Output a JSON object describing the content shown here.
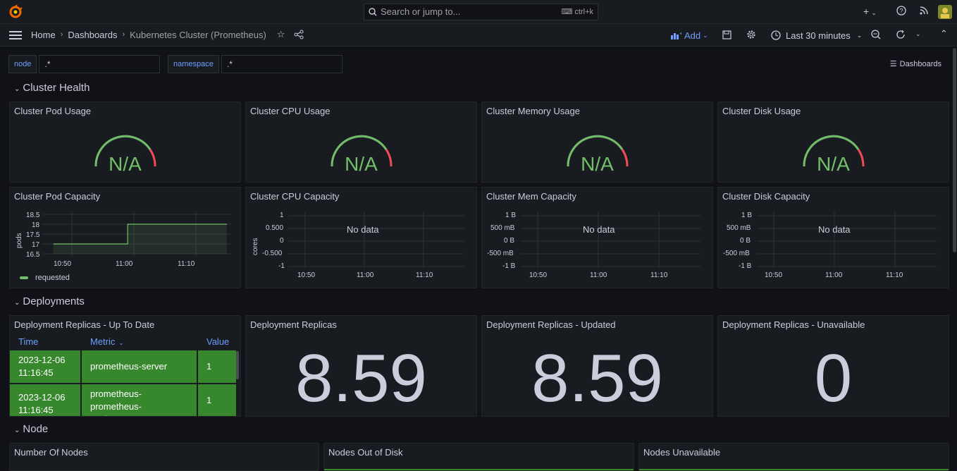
{
  "topbar": {
    "search_placeholder": "Search or jump to...",
    "search_shortcut": "ctrl+k",
    "plus_label": "+"
  },
  "nav": {
    "breadcrumbs": [
      "Home",
      "Dashboards",
      "Kubernetes Cluster (Prometheus)"
    ],
    "add_label": "Add",
    "time_range": "Last 30 minutes"
  },
  "variables": [
    {
      "label": "node",
      "value": ".*"
    },
    {
      "label": "namespace",
      "value": ".*"
    }
  ],
  "dashboards_link": "Dashboards",
  "rows": {
    "cluster_health": "Cluster Health",
    "deployments": "Deployments",
    "node": "Node"
  },
  "gauges": [
    {
      "title": "Cluster Pod Usage",
      "value": "N/A"
    },
    {
      "title": "Cluster CPU Usage",
      "value": "N/A"
    },
    {
      "title": "Cluster Memory Usage",
      "value": "N/A"
    },
    {
      "title": "Cluster Disk Usage",
      "value": "N/A"
    }
  ],
  "capacity": {
    "pod": {
      "title": "Cluster Pod Capacity",
      "ylabel": "pods",
      "yticks": [
        "18.5",
        "18",
        "17.5",
        "17",
        "16.5"
      ],
      "xticks": [
        "10:50",
        "11:00",
        "11:10"
      ],
      "legend": "requested"
    },
    "cpu": {
      "title": "Cluster CPU Capacity",
      "ylabel": "cores",
      "yticks": [
        "1",
        "0.500",
        "0",
        "-0.500",
        "-1"
      ],
      "xticks": [
        "10:50",
        "11:00",
        "11:10"
      ],
      "no_data": "No data"
    },
    "mem": {
      "title": "Cluster Mem Capacity",
      "yticks": [
        "1 B",
        "500 mB",
        "0 B",
        "-500 mB",
        "-1 B"
      ],
      "xticks": [
        "10:50",
        "11:00",
        "11:10"
      ],
      "no_data": "No data"
    },
    "disk": {
      "title": "Cluster Disk Capacity",
      "yticks": [
        "1 B",
        "500 mB",
        "0 B",
        "-500 mB",
        "-1 B"
      ],
      "xticks": [
        "10:50",
        "11:00",
        "11:10"
      ],
      "no_data": "No data"
    }
  },
  "chart_data": {
    "type": "line",
    "title": "Cluster Pod Capacity",
    "ylabel": "pods",
    "ylim": [
      16.5,
      18.5
    ],
    "xticks": [
      "10:50",
      "11:00",
      "11:10"
    ],
    "series": [
      {
        "name": "requested",
        "x": [
          "10:47",
          "10:51",
          "10:55",
          "10:59",
          "10:59",
          "11:03",
          "11:07",
          "11:11",
          "11:15"
        ],
        "values": [
          17,
          17,
          17,
          17,
          18,
          18,
          18,
          18,
          18
        ]
      }
    ]
  },
  "deployments": {
    "table": {
      "title": "Deployment Replicas - Up To Date",
      "headers": [
        "Time",
        "Metric",
        "Value"
      ],
      "rows": [
        {
          "time": "2023-12-06 11:16:45",
          "metric": "prometheus-server",
          "value": "1"
        },
        {
          "time": "2023-12-06 11:16:45",
          "metric": "prometheus-prometheus-pushgateway",
          "value": "1"
        }
      ]
    },
    "stats": [
      {
        "title": "Deployment Replicas",
        "value": "8.59"
      },
      {
        "title": "Deployment Replicas - Updated",
        "value": "8.59"
      },
      {
        "title": "Deployment Replicas - Unavailable",
        "value": "0"
      }
    ]
  },
  "node_panels": [
    "Number Of Nodes",
    "Nodes Out of Disk",
    "Nodes Unavailable"
  ],
  "colors": {
    "accent": "#6e9fff",
    "green": "#73bf69",
    "cell_green": "#37872d",
    "red": "#f2495c"
  }
}
